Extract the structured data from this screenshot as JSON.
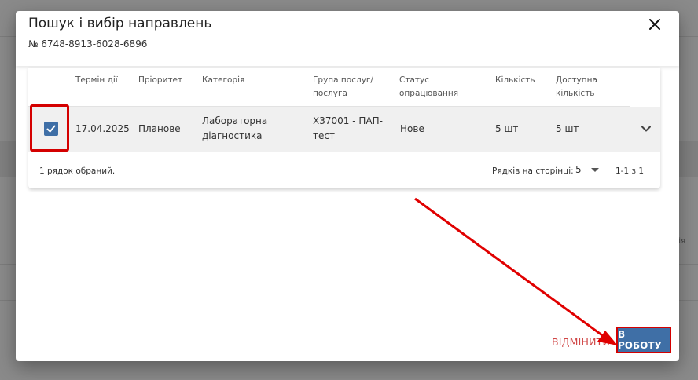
{
  "dialog": {
    "title": "Пошук і вибір направлень",
    "subtitle": "№ 6748-8913-6028-6896",
    "close_icon": "close-icon"
  },
  "table": {
    "columns": [
      {
        "key": "term",
        "label": "Термін дії"
      },
      {
        "key": "priority",
        "label": "Пріоритет"
      },
      {
        "key": "category",
        "label": "Категорія"
      },
      {
        "key": "group",
        "label": "Група послуг/ послуга"
      },
      {
        "key": "status",
        "label": "Статус опрацювання"
      },
      {
        "key": "quantity",
        "label": "Кількість"
      },
      {
        "key": "available",
        "label": "Доступна кількість"
      }
    ],
    "rows": [
      {
        "selected": true,
        "term": "17.04.2025",
        "priority": "Планове",
        "category": "Лабораторна діагностика",
        "group": "X37001 - ПАП-тест",
        "status": "Нове",
        "quantity": "5 шт",
        "available": "5 шт"
      }
    ],
    "footer": {
      "selected_text": "1 рядок обраний.",
      "rows_per_page_label": "Рядків на сторінці:",
      "rows_per_page_value": "5",
      "range_text": "1-1 з 1"
    }
  },
  "actions": {
    "cancel_label": "ВІДМІНИТИ",
    "submit_label": "В РОБОТУ"
  },
  "background": {
    "partial_text": "ія"
  },
  "colors": {
    "primary": "#3f6fa6",
    "cancel": "#d04747",
    "highlight": "#d40000",
    "overlay": "#8a8a8a"
  }
}
